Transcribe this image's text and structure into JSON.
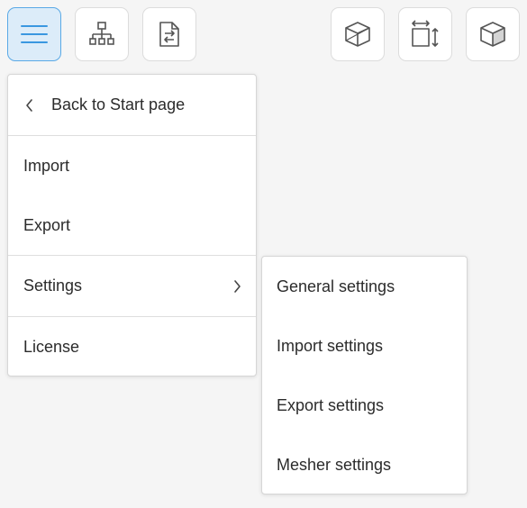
{
  "toolbar": {
    "left": [
      {
        "name": "hamburger-menu-button",
        "icon": "menu-icon",
        "active": true
      },
      {
        "name": "tree-view-button",
        "icon": "hierarchy-icon",
        "active": false
      },
      {
        "name": "file-convert-button",
        "icon": "file-swap-icon",
        "active": false
      }
    ],
    "right": [
      {
        "name": "wireframe-view-button",
        "icon": "wireframe-cube-icon"
      },
      {
        "name": "dimensions-button",
        "icon": "dimensions-icon"
      },
      {
        "name": "solid-view-button",
        "icon": "solid-cube-icon"
      }
    ],
    "active_color": "#5aa9e6",
    "icon_color": "#555555"
  },
  "main_menu": {
    "back_label": "Back to Start page",
    "import_label": "Import",
    "export_label": "Export",
    "settings_label": "Settings",
    "license_label": "License"
  },
  "settings_submenu": {
    "items": [
      "General settings",
      "Import settings",
      "Export settings",
      "Mesher settings"
    ]
  }
}
